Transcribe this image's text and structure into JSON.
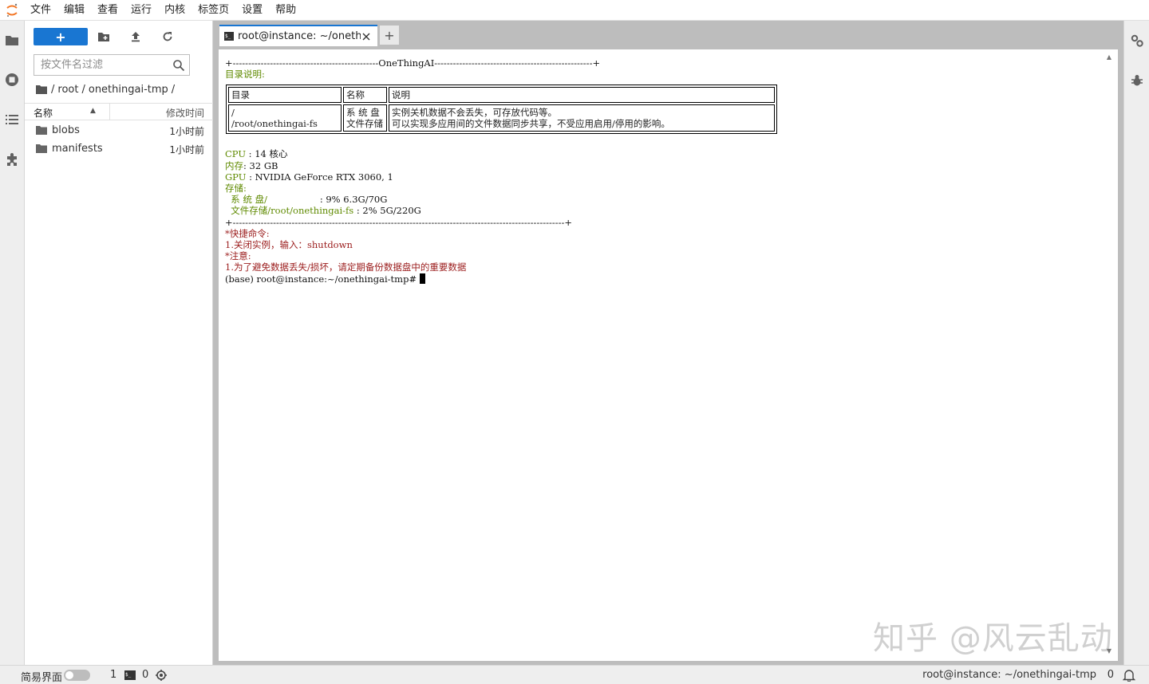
{
  "menubar": {
    "logo_icon": "jupyter-logo-icon",
    "items": [
      "文件",
      "编辑",
      "查看",
      "运行",
      "内核",
      "标签页",
      "设置",
      "帮助"
    ]
  },
  "left_rail": {
    "icons": [
      "folder-icon",
      "running-icon",
      "toc-icon",
      "extension-icon"
    ]
  },
  "filebrowser": {
    "new_label": "+",
    "tool_icons": [
      "new-folder-icon",
      "upload-icon",
      "refresh-icon"
    ],
    "filter_placeholder": "按文件名过滤",
    "breadcrumb": [
      "/",
      "root",
      "/",
      "onethingai-tmp",
      "/"
    ],
    "columns": {
      "name": "名称",
      "modified": "修改时间"
    },
    "files": [
      {
        "name": "blobs",
        "modified": "1小时前",
        "type": "folder"
      },
      {
        "name": "manifests",
        "modified": "1小时前",
        "type": "folder"
      }
    ]
  },
  "tabs": [
    {
      "label": "root@instance: ~/onethingai-tmp",
      "icon": "terminal-icon",
      "active": true
    }
  ],
  "add_tab_label": "+",
  "terminal": {
    "border_top": "+-----------------------------------------------OneThingAI---------------------------------------------------+",
    "dir_heading": "目录说明:",
    "table": {
      "headers": [
        "目录",
        "名称",
        "说明"
      ],
      "row": {
        "dir": [
          "/",
          "/root/onethingai-fs"
        ],
        "name": [
          "系 统 盘",
          "文件存储"
        ],
        "desc": [
          "实例关机数据不会丢失，可存放代码等。",
          "可以实现多应用间的文件数据同步共享，不受应用启用/停用的影响。"
        ]
      }
    },
    "specs": [
      {
        "key": "CPU",
        "sep": " : ",
        "value": "14 核心"
      },
      {
        "key": "内存",
        "sep": ": ",
        "value": "32 GB"
      },
      {
        "key": "GPU",
        "sep": " : ",
        "value": "NVIDIA GeForce RTX 3060, 1"
      }
    ],
    "storage_label": "存储:",
    "storage": [
      {
        "key": "  系 统 盘/",
        "pad": "                  ",
        "value": ": 9% 6.3G/70G"
      },
      {
        "key": "  文件存储/root/onethingai-fs",
        "pad": " ",
        "value": ": 2% 5G/220G"
      }
    ],
    "border_bottom": "+-----------------------------------------------------------------------------------------------------------+",
    "shortcut_title": "*快捷命令:",
    "shortcut_1_prefix": "1.关闭实例，输入：",
    "shortcut_1_cmd": "shutdown",
    "note_title": "*注意:",
    "note_1": "1.为了避免数据丢失/损坏，请定期备份数据盘中的重要数据",
    "prompt": "(base) root@instance:~/onethingai-tmp# "
  },
  "watermark": "知乎 @风云乱动",
  "right_rail": {
    "icons": [
      "property-inspector-icon",
      "debugger-icon"
    ]
  },
  "statusbar": {
    "simple_label": "简易界面",
    "simple_enabled": false,
    "terminals": "1",
    "kernels": "0",
    "path": "root@instance: ~/onethingai-tmp",
    "notifications": "0"
  },
  "colors": {
    "accent": "#1976d2",
    "term_green": "#5f8a00",
    "term_red": "#9b1c1c"
  }
}
